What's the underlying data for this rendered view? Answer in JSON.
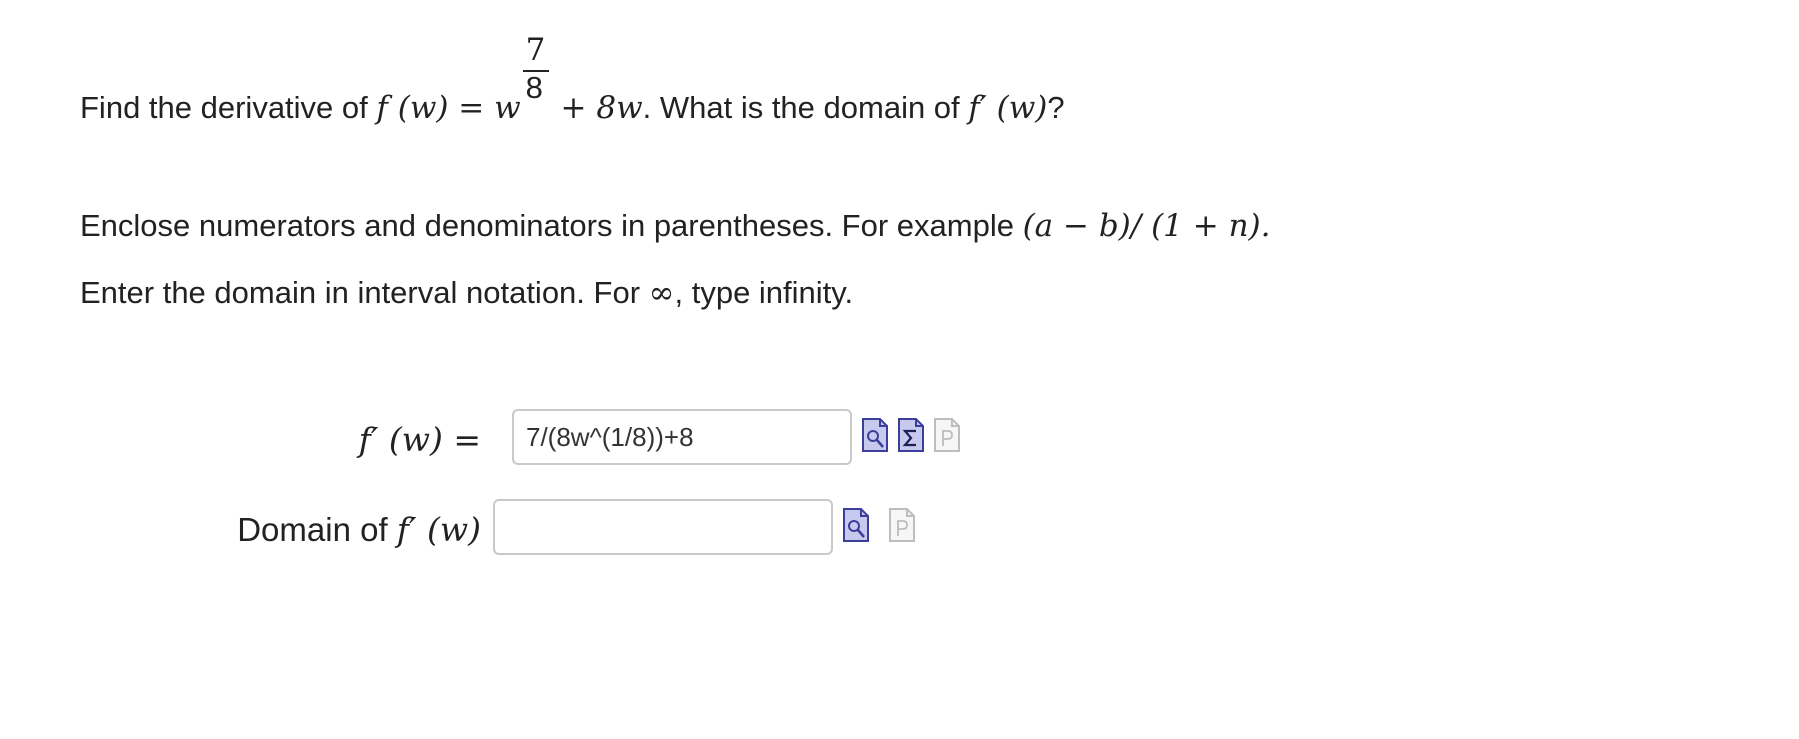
{
  "question": {
    "prefix": "Find the derivative of ",
    "func_lhs": "f (w) = w",
    "exponent_num": "7",
    "exponent_den": "8",
    "func_rest": " + 8w",
    "middle": ". What is the domain of ",
    "fprime": "f′ (w)",
    "suffix": "?"
  },
  "instructions": {
    "line1_text": "Enclose numerators and denominators in parentheses. For example ",
    "line1_example": "(a − b)/ (1 + n).",
    "line2_before": "Enter the domain in interval notation. For ",
    "line2_symbol": "∞",
    "line2_after": ", type infinity."
  },
  "answers": {
    "fprime_label": "f′ (w) =",
    "fprime_value": "7/(8w^(1/8))+8",
    "domain_label_text": "Domain of ",
    "domain_label_math": "f′ (w)",
    "domain_value": ""
  },
  "icons": {
    "preview": "preview-icon",
    "equation_editor": "equation-editor-icon",
    "help": "help-icon",
    "active_color": "#3b3f9a",
    "active_fill": "#c8c9ee",
    "disabled_color": "#bdbdbd"
  }
}
